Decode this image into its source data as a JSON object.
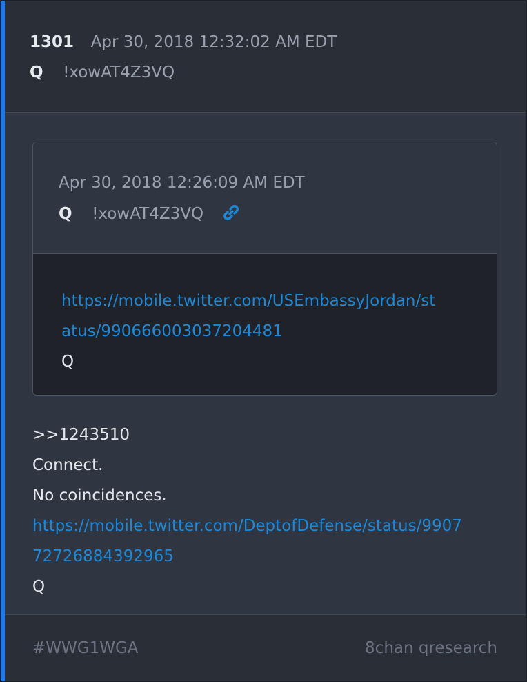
{
  "post": {
    "number": "1301",
    "date": "Apr 30, 2018 12:32:02 AM EDT",
    "author": "Q",
    "tripcode": "!xowAT4Z3VQ"
  },
  "quoted": {
    "date": "Apr 30, 2018 12:26:09 AM EDT",
    "author": "Q",
    "tripcode": "!xowAT4Z3VQ",
    "link_line1": "https://mobile.twitter.com/USEmbassyJordan/st",
    "link_line2": "atus/990666003037204481",
    "sign": "Q",
    "icon": "link-icon"
  },
  "body": {
    "reply_ref": ">>1243510",
    "line1": "Connect.",
    "line2": "No coincidences.",
    "link_line1": "https://mobile.twitter.com/DeptofDefense/status/9907",
    "link_line2": "72726884392965",
    "sign": "Q"
  },
  "footer": {
    "hashtag": "#WWG1WGA",
    "source": "8chan qresearch"
  },
  "colors": {
    "accent": "#1a7cf2",
    "link": "#1e88d6"
  }
}
